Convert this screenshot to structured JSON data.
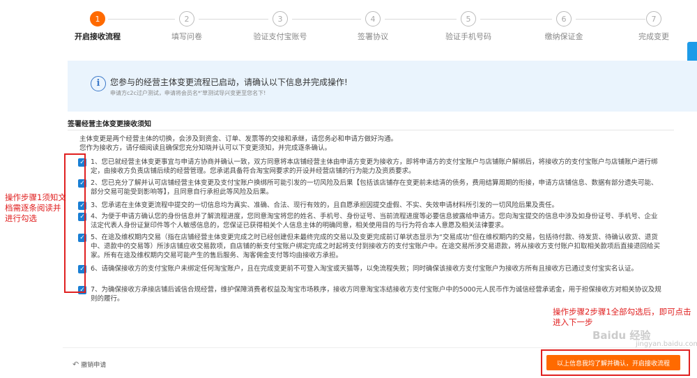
{
  "stepper": {
    "steps": [
      {
        "num": "1",
        "label": "开启接收流程",
        "active": true
      },
      {
        "num": "2",
        "label": "填写问卷"
      },
      {
        "num": "3",
        "label": "验证支付宝账号"
      },
      {
        "num": "4",
        "label": "签署协议"
      },
      {
        "num": "5",
        "label": "验证手机号码"
      },
      {
        "num": "6",
        "label": "缴纳保证金"
      },
      {
        "num": "7",
        "label": "完成变更"
      }
    ]
  },
  "banner": {
    "icon": "info-icon",
    "title": "您参与的经营主体变更流程已启动，请确认以下信息并完成操作!",
    "subtitle": "申请方c2c过户测试，申请将会员名*'草测试导兴变更至您名下!"
  },
  "notice": {
    "title": "签署经营主体变更接收须知",
    "intro": [
      "主体变更是两个经营主体的切换，会涉及到资金、订单、发票等的交接和承继，请您务必和申请方做好沟通。",
      "您作为接收方，请仔细阅读且确保您充分知晓并认可以下变更须知，并完成逐条确认。"
    ],
    "items": [
      "1、您已就经营主体变更事宜与申请方协商并确认一致，双方同意将本店铺经营主体由申请方变更为接收方，即将申请方的支付宝账户与店铺账户解绑后，将接收方的支付宝账户与店铺账户进行绑定，由接收方负责店铺后续的经营管理。您承诺具备符合淘宝网要求的开设并经营店铺的行为能力及资质要求。",
      "2、您已充分了解并认可店铺经营主体变更及支付宝账户换绑所可能引发的一切风险及后果【包括该店铺存在变更前未结清的债务，费用结算周期的衔接，申请方店铺信息、数据有部分遗失可能、部分交易可能受到影响等】，且同意自行承担此等风险及后果。",
      "3、您承诺在主体变更流程中提交的一切信息均为真实、准确、合法、现行有效的，且自愿承担因提交虚假、不实、失效申请材料所引发的一切风险后果及责任。",
      "4、为便于申请方确认您的身份信息并了解流程进度，您同意淘宝将您的姓名、手机号、身份证号、当前流程进度等必要信息披露给申请方。您向淘宝提交的信息中涉及如身份证号、手机号、企业法定代表人身份证复印件等个人敏感信息的，您保证已获得相关个人信息主体的明确同意，相关使用目的与行为符合本人意愿及相关法律要求。",
      "5、在途及维权期内交易（指在店铺经营主体变更完成之时已经创建但未最终完成的交易以及变更完成前订单状态显示为“交易成功”但在维权期内的交易，包括待付款、待发货、待确认收货、退货中、退款中的交易等）所涉店铺应收交易款项，自店铺的新支付宝账户绑定完成之时起将支付到接收方的支付宝账户中。在途交易所涉交易退款，将从接收方支付账户扣取相关款项后直接退回给买家。所有在途及维权期内交易可能产生的售后服务、淘客佣金支付等均由接收方承担。",
      "6、请确保接收方的支付宝账户未绑定任何淘宝账户，且在完成变更前不可登入淘宝或天猫等，以免流程失败；同时确保该接收方支付宝账户为接收方所有且接收方已通过支付宝实名认证。",
      "7、为确保接收方承接店铺后诚信合规经营，维护保障消费者权益及淘宝市场秩序，接收方同意淘宝冻结接收方支付宝账户中的5000元人民币作为诚信经营承诺金，用于担保接收方对相关协议及规则的履行。"
    ]
  },
  "annotations": {
    "step1": "操作步骤1须知文档需逐条阅读并进行勾选",
    "step2": "操作步骤2步骤1全部勾选后，即可点击进入下一步"
  },
  "watermark": {
    "text": "Baidu 经验",
    "url": "jingyan.baidu.com"
  },
  "footer": {
    "cancel_label": "撤销申请",
    "confirm_label": "以上信息我均了解并确认，开启接收流程"
  }
}
